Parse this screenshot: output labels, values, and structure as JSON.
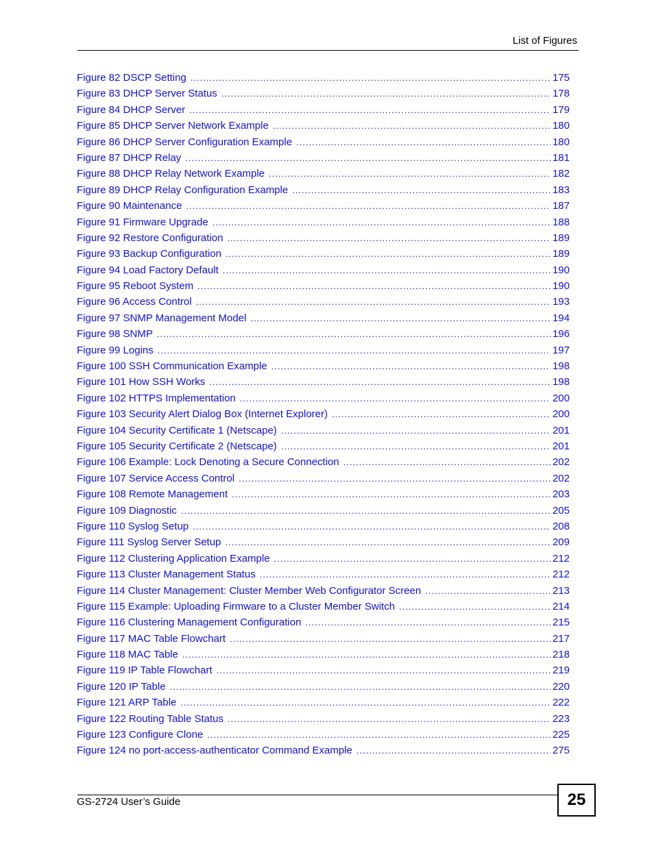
{
  "header": {
    "title": "List of Figures"
  },
  "entries": [
    {
      "title": "Figure 82 DSCP Setting",
      "page": "175"
    },
    {
      "title": "Figure 83 DHCP Server Status",
      "page": "178"
    },
    {
      "title": "Figure 84 DHCP Server",
      "page": "179"
    },
    {
      "title": "Figure 85 DHCP Server Network Example",
      "page": "180"
    },
    {
      "title": "Figure 86 DHCP Server Configuration Example",
      "page": "180"
    },
    {
      "title": "Figure 87 DHCP Relay",
      "page": "181"
    },
    {
      "title": "Figure 88 DHCP Relay Network Example",
      "page": "182"
    },
    {
      "title": "Figure 89 DHCP Relay Configuration Example",
      "page": "183"
    },
    {
      "title": "Figure 90 Maintenance",
      "page": "187"
    },
    {
      "title": "Figure 91 Firmware Upgrade",
      "page": "188"
    },
    {
      "title": "Figure 92 Restore Configuration",
      "page": "189"
    },
    {
      "title": "Figure 93 Backup Configuration",
      "page": "189"
    },
    {
      "title": "Figure 94 Load Factory Default",
      "page": "190"
    },
    {
      "title": "Figure 95 Reboot System",
      "page": "190"
    },
    {
      "title": "Figure 96 Access Control",
      "page": "193"
    },
    {
      "title": "Figure 97 SNMP Management Model",
      "page": "194"
    },
    {
      "title": "Figure 98 SNMP",
      "page": "196"
    },
    {
      "title": "Figure 99 Logins",
      "page": "197"
    },
    {
      "title": "Figure 100 SSH Communication Example",
      "page": "198"
    },
    {
      "title": "Figure 101 How SSH Works",
      "page": "198"
    },
    {
      "title": "Figure 102 HTTPS Implementation",
      "page": "200"
    },
    {
      "title": "Figure 103 Security Alert Dialog Box (Internet Explorer)",
      "page": "200"
    },
    {
      "title": "Figure 104 Security Certificate 1 (Netscape)",
      "page": "201"
    },
    {
      "title": "Figure 105 Security Certificate 2 (Netscape)",
      "page": "201"
    },
    {
      "title": "Figure 106 Example: Lock Denoting a Secure Connection",
      "page": "202"
    },
    {
      "title": "Figure 107 Service Access Control",
      "page": "202"
    },
    {
      "title": "Figure 108 Remote Management",
      "page": "203"
    },
    {
      "title": "Figure 109 Diagnostic",
      "page": "205"
    },
    {
      "title": "Figure 110 Syslog Setup",
      "page": "208"
    },
    {
      "title": "Figure 111 Syslog Server Setup",
      "page": "209"
    },
    {
      "title": "Figure 112 Clustering Application Example",
      "page": "212"
    },
    {
      "title": "Figure 113 Cluster Management Status",
      "page": "212"
    },
    {
      "title": "Figure 114 Cluster Management: Cluster Member Web Configurator Screen",
      "page": "213"
    },
    {
      "title": "Figure 115 Example: Uploading Firmware to a Cluster Member Switch",
      "page": "214"
    },
    {
      "title": "Figure 116 Clustering Management Configuration",
      "page": "215"
    },
    {
      "title": "Figure 117 MAC Table Flowchart",
      "page": "217"
    },
    {
      "title": "Figure 118 MAC Table",
      "page": "218"
    },
    {
      "title": "Figure 119 IP Table Flowchart",
      "page": "219"
    },
    {
      "title": "Figure 120 IP Table",
      "page": "220"
    },
    {
      "title": "Figure 121 ARP Table",
      "page": "222"
    },
    {
      "title": "Figure 122 Routing Table Status",
      "page": "223"
    },
    {
      "title": "Figure 123 Configure Clone",
      "page": "225"
    },
    {
      "title": "Figure 124 no port-access-authenticator Command Example",
      "page": "275"
    }
  ],
  "footer": {
    "guide_title": "GS-2724 User’s Guide",
    "page_number": "25"
  },
  "colors": {
    "link": "#1010e0",
    "text": "#000000"
  }
}
